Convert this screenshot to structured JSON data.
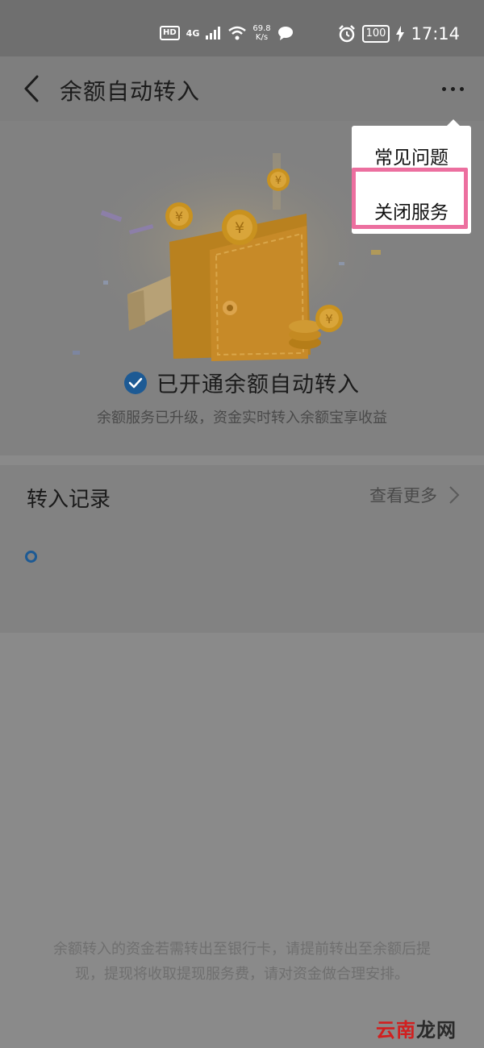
{
  "status_bar": {
    "hd": "HD",
    "network": "4G",
    "speed_value": "69.8",
    "speed_unit": "K/s",
    "battery": "100",
    "time": "17:14"
  },
  "header": {
    "title": "余额自动转入",
    "back_icon": "chevron-left-icon",
    "more_icon": "more-horizontal-icon"
  },
  "hero": {
    "status_text": "已开通余额自动转入",
    "sub_text": "余额服务已升级，资金实时转入余额宝享收益"
  },
  "records": {
    "title": "转入记录",
    "more_label": "查看更多"
  },
  "disclaimer": "余额转入的资金若需转出至银行卡，请提前转出至余额后提现，提现将收取提现服务费，请对资金做合理安排。",
  "menu": {
    "items": [
      "常见问题",
      "关闭服务"
    ]
  },
  "watermark": {
    "part1": "云南",
    "part2": "龙网"
  },
  "colors": {
    "accent": "#1d5a94",
    "highlight": "#ec6f9f"
  }
}
